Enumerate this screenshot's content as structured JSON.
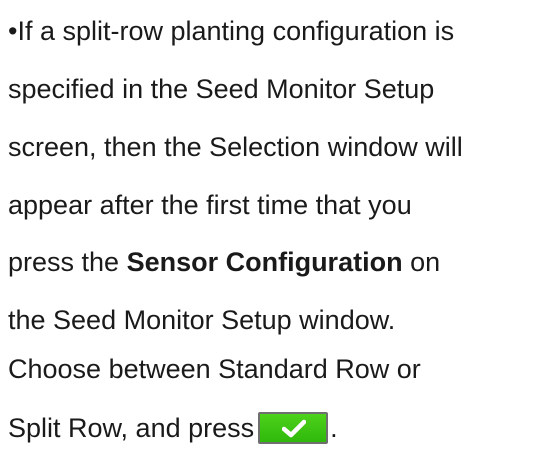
{
  "text": {
    "line1": "•If a split-row planting configuration is",
    "line2": "specified in the Seed Monitor Setup",
    "line3": "screen, then the Selection window will",
    "line4": "appear after the first time that you",
    "line5_pre": "press the ",
    "line5_bold": "Sensor Configuration",
    "line5_post": " on",
    "line6": "the Seed Monitor Setup window.",
    "line7": "Choose between Standard Row or",
    "line8_pre": "Split Row, and press",
    "line8_post": "."
  },
  "icons": {
    "confirm_button": "checkmark-icon"
  },
  "colors": {
    "confirm_button": "#3cc514",
    "text": "#1a1a1a"
  }
}
